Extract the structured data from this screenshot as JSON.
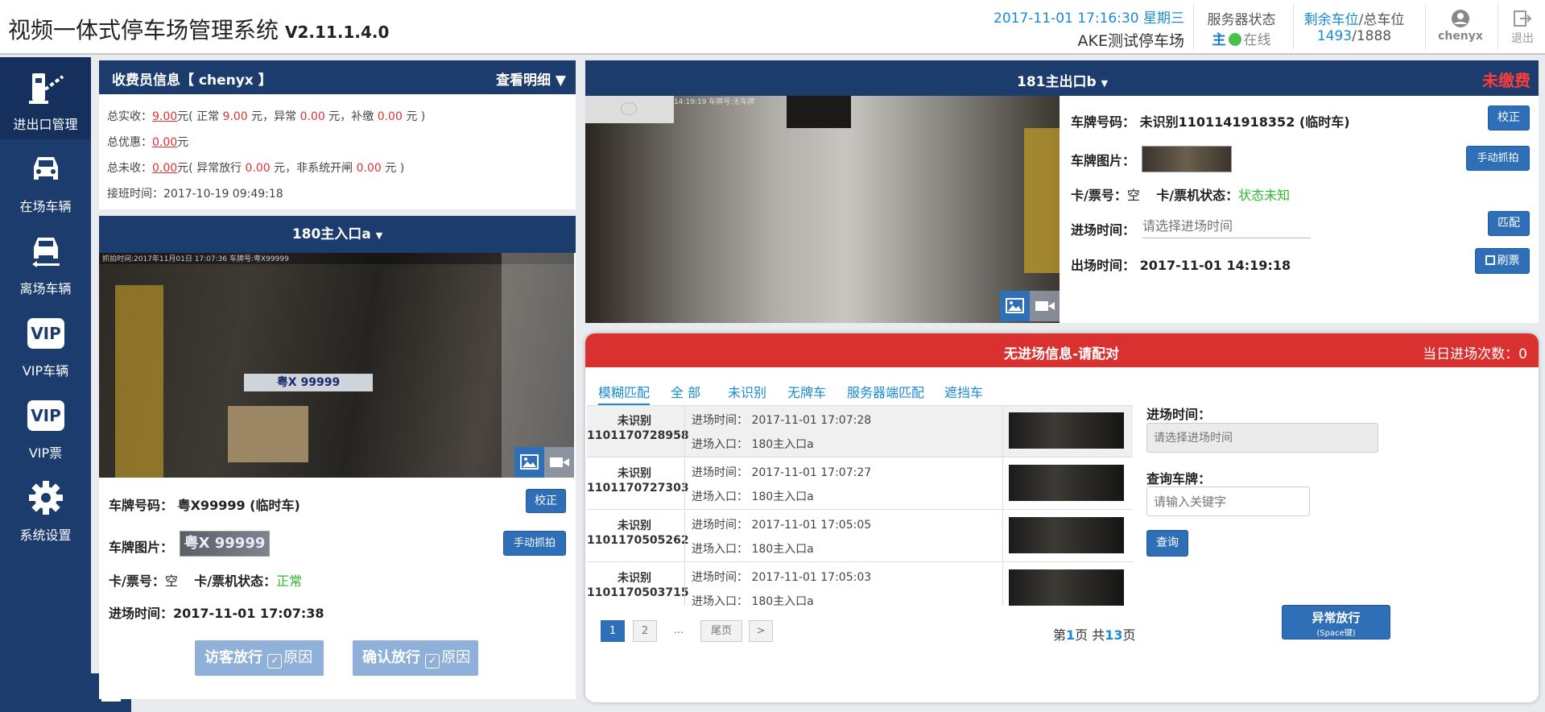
{
  "header": {
    "title": "视频一体式停车场管理系统",
    "version": "V2.11.1.4.0",
    "datetime": "2017-11-01 17:16:30 星期三",
    "lot_name": "AKE测试停车场",
    "server_label": "服务器状态",
    "server_role": "主",
    "server_status": "在线",
    "spaces_label_remaining": "剩余车位",
    "spaces_label_total": "/总车位",
    "spaces_remaining": "1493",
    "spaces_total": "/1888",
    "username": "chenyx",
    "logout_label": "退出",
    "accent_color": "#1a8ad4"
  },
  "sidebar": {
    "items": [
      {
        "label": "进出口管理",
        "icon": "barrier-gate-icon"
      },
      {
        "label": "在场车辆",
        "icon": "car-front-icon"
      },
      {
        "label": "离场车辆",
        "icon": "car-exit-icon"
      },
      {
        "label": "VIP车辆",
        "icon": "vip-icon"
      },
      {
        "label": "VIP票",
        "icon": "vip-ticket-icon"
      },
      {
        "label": "系统设置",
        "icon": "gear-icon"
      }
    ],
    "vip_text": "VIP",
    "bg_color": "#1d3c6e"
  },
  "cashier": {
    "title": "收费员信息【 chenyx 】",
    "detail_link": "查看明细",
    "line1": {
      "label": "总实收：",
      "total": "9.00",
      "unit": "元",
      "p1": "( 正常 ",
      "normal": "9.00",
      "p2": " 元，异常 ",
      "abnormal": "0.00",
      "p3": " 元，补缴 ",
      "supplement": "0.00",
      "p4": " 元 )"
    },
    "line2": {
      "label": "总优惠：",
      "value": "0.00",
      "unit": "元"
    },
    "line3": {
      "label": "总未收：",
      "value": "0.00",
      "unit": "元",
      "p1": "( 异常放行 ",
      "abnormal": "0.00",
      "p2": " 元，非系统开闸 ",
      "manual": "0.00",
      "p3": " 元 )"
    },
    "shift_label": "接班时间：",
    "shift_time": "2017-10-19 09:49:18"
  },
  "entrance": {
    "title": "180主入口a",
    "cam_overlay": "抓拍时间:2017年11月01日 17:07:36 车牌号:粤X99999",
    "plate_label": "车牌号码：",
    "plate_value": "粤X99999 (临时车)",
    "correct_btn": "校正",
    "image_label": "车牌图片：",
    "plate_img_text": "粤X 99999",
    "capture_btn": "手动抓拍",
    "card_label": "卡/票号：",
    "card_value": "空",
    "machine_label": "卡/票机状态：",
    "machine_status": "正常",
    "time_label": "进场时间：",
    "time_value": "2017-11-01 17:07:38",
    "visitor_btn": "访客放行",
    "confirm_btn": "确认放行",
    "reason": "原因"
  },
  "exit": {
    "title": "181主出口b",
    "status": "未缴费",
    "cam_overlay": "14:19:19 车牌号:无车牌",
    "plate_label": "车牌号码：",
    "plate_value": "未识别1101141918352 (临时车)",
    "correct_btn": "校正",
    "image_label": "车牌图片：",
    "capture_btn": "手动抓拍",
    "card_label": "卡/票号：",
    "card_value": "空",
    "machine_label": "卡/票机状态：",
    "machine_status": "状态未知",
    "entry_label": "进场时间：",
    "entry_placeholder": "请选择进场时间",
    "match_btn": "匹配",
    "exit_label": "出场时间：",
    "exit_time": "2017-11-01 14:19:18",
    "refresh_btn": "刷票"
  },
  "match": {
    "title": "无进场信息-请配对",
    "count_label": "当日进场次数：0",
    "tabs": [
      "模糊匹配",
      "全 部",
      "未识别",
      "无牌车",
      "服务器端匹配",
      "遮挡车"
    ],
    "rows": [
      {
        "plate1": "未识别",
        "plate2": "1101170728958",
        "time_label": "进场时间：",
        "time": "2017-11-01 17:07:28",
        "gate_label": "进场入口：",
        "gate": "180主入口a"
      },
      {
        "plate1": "未识别",
        "plate2": "1101170727303",
        "time_label": "进场时间：",
        "time": "2017-11-01 17:07:27",
        "gate_label": "进场入口：",
        "gate": "180主入口a"
      },
      {
        "plate1": "未识别",
        "plate2": "1101170505262",
        "time_label": "进场时间：",
        "time": "2017-11-01 17:05:05",
        "gate_label": "进场入口：",
        "gate": "180主入口a"
      },
      {
        "plate1": "未识别",
        "plate2": "1101170503715",
        "time_label": "进场时间：",
        "time": "2017-11-01 17:05:03",
        "gate_label": "进场入口：",
        "gate": "180主入口a"
      }
    ],
    "pages": [
      "1",
      "2",
      "...",
      "尾页",
      ">"
    ],
    "page_info_a": "第",
    "page_current": "1",
    "page_info_b": "页 共",
    "page_total": "13",
    "page_info_c": "页",
    "filter_time_label": "进场时间：",
    "filter_time_placeholder": "请选择进场时间",
    "filter_plate_label": "查询车牌：",
    "filter_plate_placeholder": "请输入关键字",
    "query_btn": "查询",
    "abnormal_btn": "异常放行",
    "abnormal_hint": "(Space键)",
    "header_color": "#d93030"
  }
}
